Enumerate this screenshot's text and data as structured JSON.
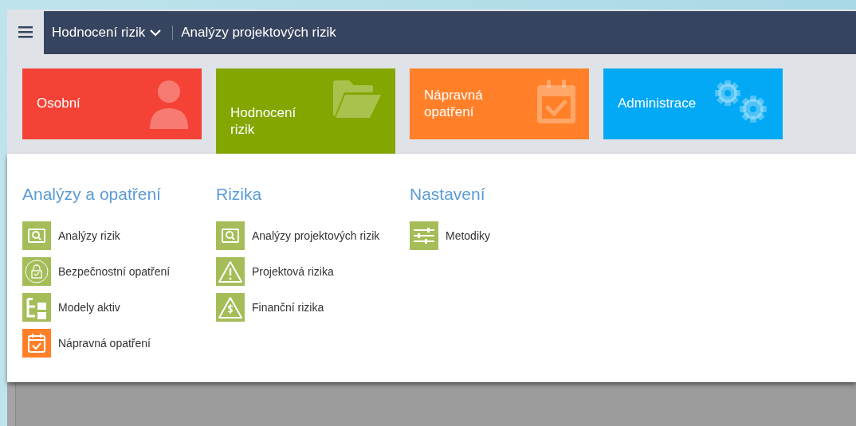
{
  "header": {
    "module": "Hodnocení rizik",
    "page": "Analýzy projektových rizik"
  },
  "tiles": [
    {
      "label": "Osobní",
      "kind": "person",
      "color": "#f44336",
      "selected": false
    },
    {
      "label": "Hodnocení rizik",
      "kind": "folder",
      "color": "#84a600",
      "selected": true
    },
    {
      "label": "Nápravná opatření",
      "kind": "calendar",
      "color": "#ff8029",
      "selected": false
    },
    {
      "label": "Administrace",
      "kind": "gears",
      "color": "#03a9f4",
      "selected": false
    }
  ],
  "sections": [
    {
      "title": "Analýzy a opatření",
      "items": [
        {
          "label": "Analýzy rizik",
          "kind": "search",
          "color": "#a4bd58"
        },
        {
          "label": "Bezpečnostní opatření",
          "kind": "lock",
          "color": "#a4bd58"
        },
        {
          "label": "Modely aktiv",
          "kind": "tree",
          "color": "#a4bd58"
        },
        {
          "label": "Nápravná opatření",
          "kind": "calendar",
          "color": "#ff8029"
        }
      ]
    },
    {
      "title": "Rizika",
      "items": [
        {
          "label": "Analýzy projektových rizik",
          "kind": "search",
          "color": "#a4bd58"
        },
        {
          "label": "Projektová rizika",
          "kind": "warning",
          "color": "#a4bd58"
        },
        {
          "label": "Finanční rizika",
          "kind": "dollar",
          "color": "#a4bd58"
        }
      ]
    },
    {
      "title": "Nastavení",
      "items": [
        {
          "label": "Metodiky",
          "kind": "sliders",
          "color": "#a4bd58"
        }
      ]
    }
  ]
}
